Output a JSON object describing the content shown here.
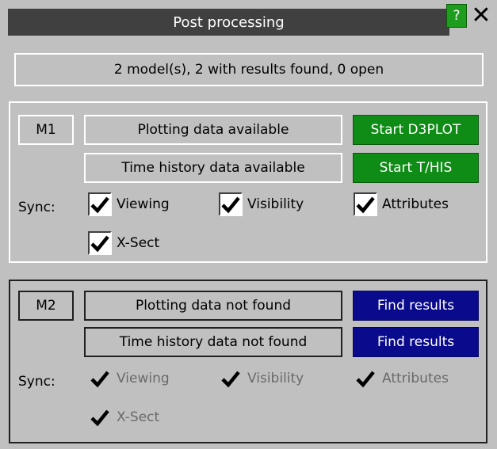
{
  "window": {
    "title": "Post processing",
    "help_label": "?",
    "close_label": "✕"
  },
  "summary": "2 model(s), 2 with results found, 0 open",
  "models": [
    {
      "id": "M1",
      "plot_status": "Plotting data available",
      "plot_button": "Start D3PLOT",
      "thist_status": "Time history data available",
      "thist_button": "Start T/HIS",
      "sync_label": "Sync:",
      "sync": {
        "viewing": "Viewing",
        "visibility": "Visibility",
        "attributes": "Attributes",
        "xsect": "X-Sect"
      },
      "button_color": "#0f8c16",
      "enabled": true
    },
    {
      "id": "M2",
      "plot_status": "Plotting data not found",
      "plot_button": "Find results",
      "thist_status": "Time history data not found",
      "thist_button": "Find results",
      "sync_label": "Sync:",
      "sync": {
        "viewing": "Viewing",
        "visibility": "Visibility",
        "attributes": "Attributes",
        "xsect": "X-Sect"
      },
      "button_color": "#0a0a8c",
      "enabled": false
    }
  ]
}
